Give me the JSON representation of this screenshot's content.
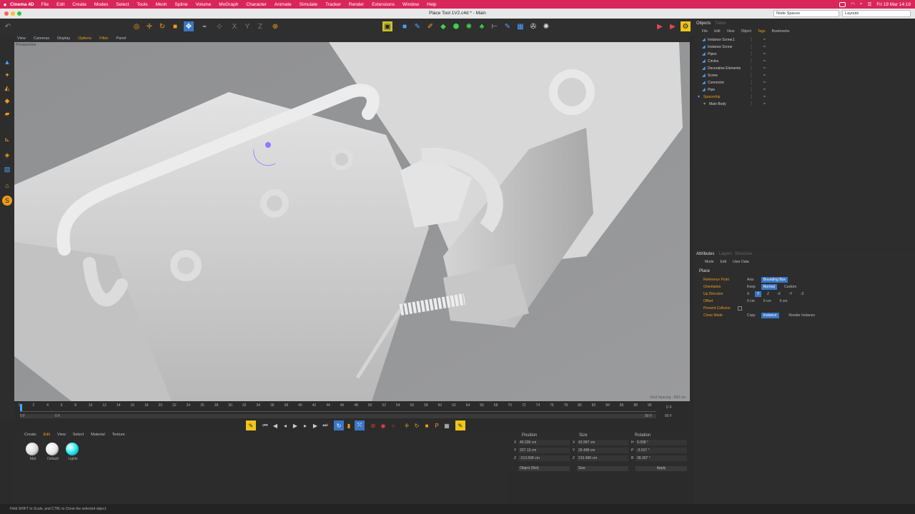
{
  "macbar": {
    "app_name": "Cinema 4D",
    "menus": [
      "File",
      "Edit",
      "Create",
      "Modes",
      "Select",
      "Tools",
      "Mesh",
      "Spline",
      "Volume",
      "MoGraph",
      "Character",
      "Animate",
      "Simulate",
      "Tracker",
      "Render",
      "Extensions",
      "Window",
      "Help"
    ],
    "clock": "Fri 19 Mar 14:19"
  },
  "titlebar": {
    "title": "Place Tool 1V2.c4d * - Main",
    "node_spaces": "Node Spaces",
    "layouts": "Layouts"
  },
  "viewport": {
    "menu": [
      "View",
      "Cameras",
      "Display",
      "Options",
      "Filter",
      "Panel"
    ],
    "label": "Perspective",
    "grid_spacing": "Grid Spacing : 500 cm"
  },
  "timeline": {
    "ticks": [
      "0",
      "2",
      "4",
      "6",
      "8",
      "10",
      "12",
      "14",
      "16",
      "18",
      "20",
      "22",
      "24",
      "26",
      "28",
      "30",
      "32",
      "34",
      "36",
      "38",
      "40",
      "42",
      "44",
      "46",
      "48",
      "50",
      "52",
      "54",
      "56",
      "58",
      "60",
      "62",
      "64",
      "66",
      "68",
      "70",
      "72",
      "74",
      "76",
      "78",
      "80",
      "82",
      "84",
      "86",
      "88",
      "90"
    ],
    "start_left": "0 F",
    "start_right": "0 F",
    "end_field": "90 F",
    "end_right": "90 F",
    "current_frame": "0 F"
  },
  "materials": {
    "menu": [
      "Create",
      "Edit",
      "View",
      "Select",
      "Material",
      "Texture"
    ],
    "items": [
      {
        "name": "Mat",
        "color": "#d9d9d9"
      },
      {
        "name": "Default",
        "color": "#e6e6e6"
      },
      {
        "name": "Lights",
        "color": "#12e6f2"
      }
    ]
  },
  "coords": {
    "headers": [
      "Position",
      "Size",
      "Rotation"
    ],
    "rows": [
      {
        "axis": "X",
        "pos": "45.036 cm",
        "size_axis": "X",
        "size": "43.997 cm",
        "rot_axis": "H",
        "rot": "0.008 °"
      },
      {
        "axis": "Y",
        "pos": "227.13 cm",
        "size_axis": "Y",
        "size": "26.498 cm",
        "rot_axis": "P",
        "rot": "-0.017 °"
      },
      {
        "axis": "Z",
        "pos": "-213.698 cm",
        "size_axis": "Z",
        "size": "210.998 cm",
        "rot_axis": "B",
        "rot": "39.307 °"
      }
    ],
    "mode": "Object (Rel)",
    "size_mode": "Size",
    "apply": "Apply"
  },
  "objects": {
    "tabs": [
      "Objects",
      "Takes"
    ],
    "menu": [
      "File",
      "Edit",
      "View",
      "Object",
      "Tags",
      "Bookmarks"
    ],
    "items": [
      {
        "name": "Instance Screw.1"
      },
      {
        "name": "Instance Screw"
      },
      {
        "name": "Pipes"
      },
      {
        "name": "Circles"
      },
      {
        "name": "Decorative Elements"
      },
      {
        "name": "Screw"
      },
      {
        "name": "Connector"
      },
      {
        "name": "Pipe"
      },
      {
        "name": "Spaceship"
      },
      {
        "name": "Main Body"
      }
    ]
  },
  "attributes": {
    "tabs": [
      "Attributes",
      "Layers",
      "Structure"
    ],
    "menu": [
      "Mode",
      "Edit",
      "User Data"
    ],
    "section": "Place",
    "rows": [
      {
        "label": "Reference Point",
        "options": [
          "Axis",
          "Bounding Box"
        ],
        "active": 1
      },
      {
        "label": "Orientation",
        "options": [
          "Keep",
          "Normal",
          "Custom"
        ],
        "active": 1
      },
      {
        "label": "Up Direction",
        "options": [
          "X",
          "Y",
          "Z",
          "-X",
          "-Y",
          "-Z"
        ],
        "active": 1
      },
      {
        "label": "Offset",
        "options": [
          "0 cm",
          "0 cm",
          "0 cm"
        ],
        "active": -1
      },
      {
        "label": "Prevent Collision",
        "options": [],
        "active": -1
      },
      {
        "label": "Clone Mode",
        "options": [
          "Copy",
          "Instance",
          "Render Instance"
        ],
        "active": 1
      }
    ]
  },
  "status": {
    "text": "Hold SHIFT to Scale, and CTRL to Clone the selected object."
  },
  "colors": {
    "accent": "#3b76c4",
    "orange": "#f19a1a",
    "macbar": "#d9265a"
  }
}
